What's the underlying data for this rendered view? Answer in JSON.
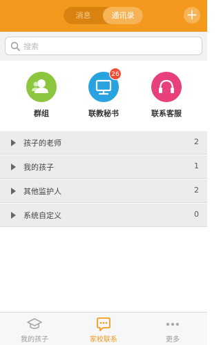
{
  "header": {
    "segment_left": "消息",
    "segment_right": "通讯录",
    "add_button": "+"
  },
  "search": {
    "placeholder": "搜索"
  },
  "quick_actions": [
    {
      "label": "群组",
      "icon": "group-icon",
      "color": "#8cc63f"
    },
    {
      "label": "联教秘书",
      "icon": "monitor-icon",
      "color": "#29a3e0",
      "badge": "26"
    },
    {
      "label": "联系客服",
      "icon": "headset-icon",
      "color": "#e8407a"
    }
  ],
  "contact_groups": [
    {
      "label": "孩子的老师",
      "count": "2"
    },
    {
      "label": "我的孩子",
      "count": "1"
    },
    {
      "label": "其他监护人",
      "count": "2"
    },
    {
      "label": "系统自定义",
      "count": "0"
    }
  ],
  "tabbar": {
    "items": [
      {
        "label": "我的孩子",
        "icon": "graduation-cap-icon",
        "active": false
      },
      {
        "label": "家校联系",
        "icon": "chat-bubble-icon",
        "active": true
      },
      {
        "label": "更多",
        "icon": "more-dots-icon",
        "active": false
      }
    ]
  },
  "colors": {
    "accent": "#f39a1e",
    "group_green": "#8cc63f",
    "secretary_blue": "#29a3e0",
    "service_pink": "#e8407a",
    "badge_red": "#ee4f37"
  }
}
